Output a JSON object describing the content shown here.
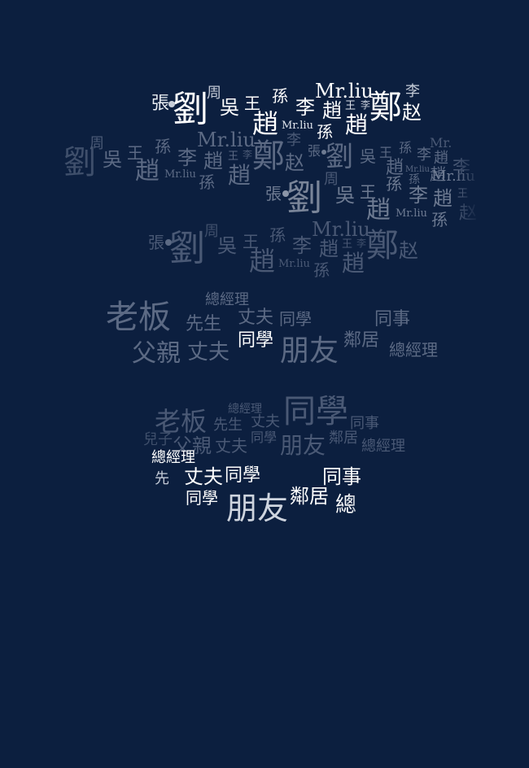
{
  "colors": {
    "background": "#0c1f3f",
    "bright": "#ffffff",
    "mid": "#9aa4b4",
    "dim": "#4a5975"
  },
  "cluster1": {
    "zhang": "張",
    "liu_big": "劉",
    "zhou": "周",
    "wu": "吳",
    "wang": "王",
    "sun": "孫",
    "mrliu": "Mr.liu",
    "li": "李",
    "zhao": "趙",
    "zhao_b": "趙",
    "wang_small": "王",
    "li_small": "李",
    "zheng": "鄭",
    "zhao_simpl": "赵",
    "mrliu_small": "Mr.liu",
    "sun_b": "孫",
    "zhao_c": "趙",
    "li_c": "李"
  },
  "cluster2": {
    "zhou": "周",
    "liu_left": "劉",
    "wu": "吳",
    "wang": "王",
    "sun": "孫",
    "zhao": "趙",
    "mrliu_small": "Mr.liu",
    "li": "李",
    "zhao_b": "趙",
    "wang_small": "王",
    "li_small": "李",
    "zheng": "鄭",
    "zhao_simpl": "赵",
    "sun_b": "孫",
    "zhao_c": "趙",
    "mrliu": "Mr.liu",
    "li_top": "李",
    "zhang": "張",
    "liu": "劉",
    "wu_r": "吳",
    "wang_r": "王",
    "sun_r": "孫",
    "li_r": "李",
    "zhao_r": "趙",
    "zhao_r2": "趙",
    "mrliu_r": "Mr.liu",
    "sun_r2": "孫",
    "zhao_sr": "趙",
    "mrliu_far": "Mr.",
    "mrliu_far2": "Mr.liu",
    "zhang2": "張",
    "liu2": "劉",
    "wu2": "吳",
    "wang2": "王",
    "sun2": "孫",
    "li2": "李",
    "zhao2": "趙",
    "zhao2b": "趙",
    "mrliu2": "Mr.liu",
    "sun2b": "孫",
    "wang2s": "王",
    "zhou2": "周",
    "zhao2s": "赵",
    "li_far": "李"
  },
  "cluster3": {
    "zhang": "張",
    "liu": "劉",
    "zhou": "周",
    "wu": "吳",
    "wang": "王",
    "sun": "孫",
    "mrliu": "Mr.liu",
    "li": "李",
    "zhao": "趙",
    "zhao_b": "趙",
    "wang_small": "王",
    "li_small": "李",
    "zheng": "鄭",
    "zhao_simpl": "赵",
    "mrliu_small": "Mr.liu",
    "sun_b": "孫",
    "zhao_c": "趙"
  },
  "cluster4": {
    "laoban": "老板",
    "zongjingli": "總經理",
    "xiansheng": "先生",
    "zhangfu": "丈夫",
    "tongxue": "同學",
    "tongshi": "同事",
    "fuqin": "父親",
    "zhangfu2": "丈夫",
    "tongxue_bright": "同學",
    "pengyou": "朋友",
    "linju": "鄰居",
    "zongjingli2": "總經理"
  },
  "cluster5": {
    "zongjingli": "總經理",
    "tongxue_big": "同學",
    "laoban": "老板",
    "xiansheng": "先生",
    "zhangfu": "丈夫",
    "tongshi": "同事",
    "erzi": "兒子",
    "fuqin": "父親",
    "zhangfu2": "丈夫",
    "tongxue_small": "同學",
    "pengyou": "朋友",
    "linju": "鄰居",
    "zongjingli2": "總經理"
  },
  "cluster6": {
    "zongjingli": "總經理",
    "xiansheng_frag": "先",
    "zhangfu": "丈夫",
    "tongxue": "同學",
    "tongshi": "同事",
    "tongxue2": "同學",
    "pengyou": "朋友",
    "linju": "鄰居",
    "zong_frag": "總"
  }
}
